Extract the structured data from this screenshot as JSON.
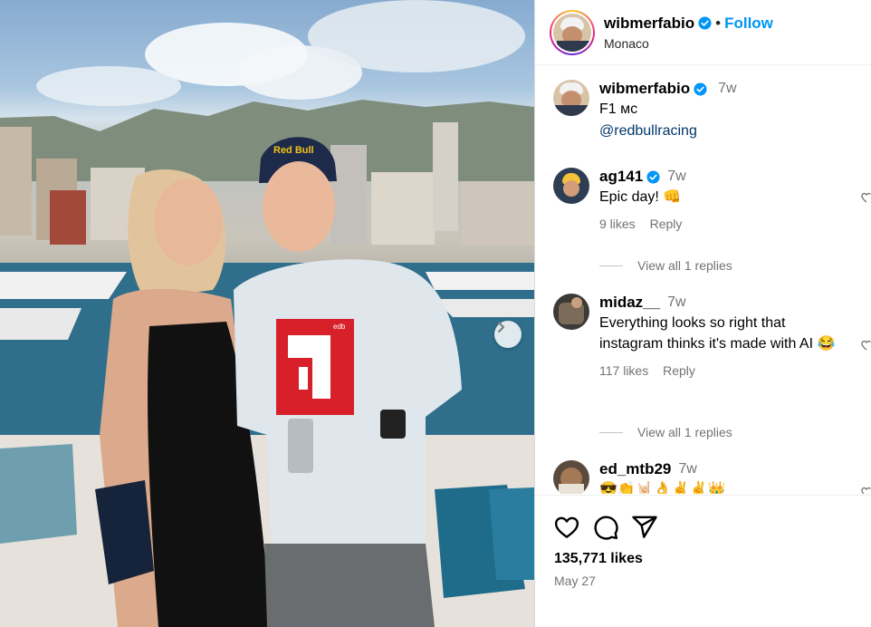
{
  "post": {
    "username": "wibmerfabio",
    "follow_label": "Follow",
    "location": "Monaco",
    "separator": "•"
  },
  "caption": {
    "username": "wibmerfabio",
    "time": "7w",
    "line1": "F1 мс",
    "mention": "@redbullracing"
  },
  "comments": [
    {
      "username": "ag141",
      "verified": true,
      "time": "7w",
      "text": "Epic day! 👊",
      "likes": "9 likes",
      "reply": "Reply"
    },
    {
      "username": "midaz__",
      "verified": false,
      "time": "7w",
      "text": "Everything looks so right that instagram thinks it's made with AI 😂",
      "likes": "117 likes",
      "reply": "Reply"
    },
    {
      "username": "ed_mtb29",
      "verified": false,
      "time": "7w",
      "text": "😎👏🤘🏻👌✌️✌️👑"
    }
  ],
  "view_replies": [
    "View all 1 replies",
    "View all 1 replies"
  ],
  "footer": {
    "likes": "135,771 likes",
    "date": "May 27"
  },
  "photo": {
    "cap_text": "Red Bull",
    "shirt_logo_text": "edb"
  },
  "colors": {
    "accent": "#0095f6",
    "verified": "#0095f6",
    "mention": "#00376b",
    "secondary_text": "#737373"
  }
}
